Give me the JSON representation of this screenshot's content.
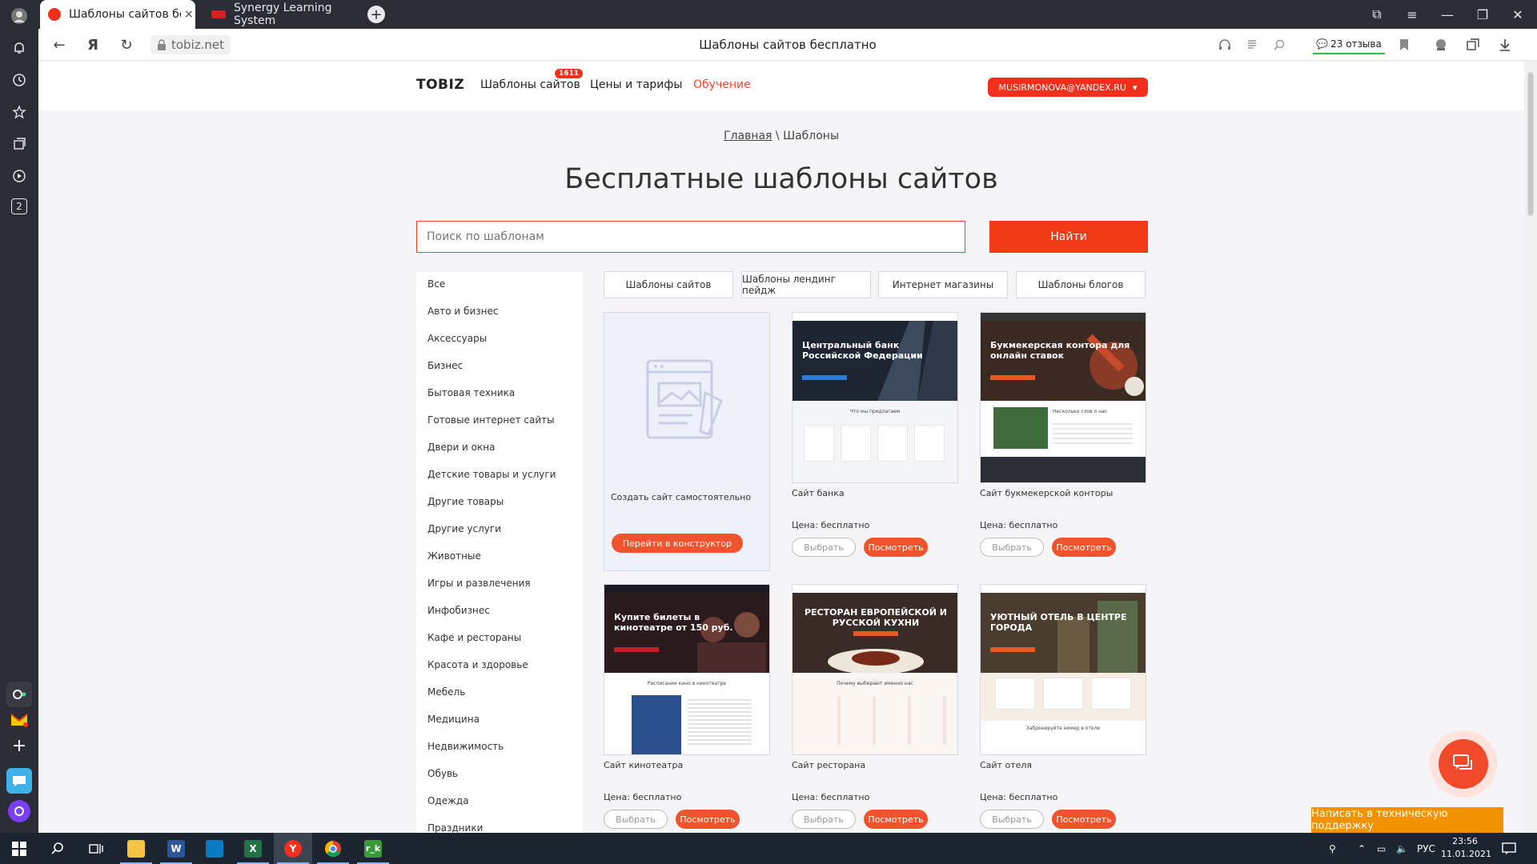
{
  "browser": {
    "tabs": [
      {
        "title": "Шаблоны сайтов бесп...",
        "active": true,
        "favicon_color": "#f0301c"
      },
      {
        "title": "Synergy Learning System",
        "active": false,
        "favicon_color": "#d42020"
      }
    ],
    "close_glyph": "×",
    "new_tab_glyph": "+",
    "url": "tobiz.net",
    "page_title": "Шаблоны сайтов бесплатно",
    "reviews_label": "23 отзыва",
    "window_buttons": [
      "⧉",
      "≡",
      "—",
      "❐",
      "✕"
    ],
    "nav_glyphs": {
      "back": "←",
      "yandex": "Я",
      "reload": "↻"
    },
    "sidebar_badge": "2"
  },
  "site": {
    "logo": "TOBIZ",
    "nav": {
      "templates": "Шаблоны сайтов",
      "templates_badge": "1611",
      "pricing": "Цены и тарифы",
      "learning": "Обучение"
    },
    "user_email": "MUSIRMONOVA@YANDEX.RU",
    "user_caret": "▾",
    "breadcrumb": {
      "home": "Главная",
      "separator": " \\ ",
      "current": "Шаблоны"
    },
    "heading": "Бесплатные шаблоны сайтов",
    "search": {
      "placeholder": "Поиск по шаблонам",
      "button": "Найти"
    },
    "categories": [
      "Все",
      "Авто и бизнес",
      "Аксессуары",
      "Бизнес",
      "Бытовая техника",
      "Готовые интернет сайты",
      "Двери и окна",
      "Детские товары и услуги",
      "Другие товары",
      "Другие услуги",
      "Животные",
      "Игры и развлечения",
      "Инфобизнес",
      "Кафе и рестораны",
      "Красота и здоровье",
      "Мебель",
      "Медицина",
      "Недвижимость",
      "Обувь",
      "Одежда",
      "Праздники"
    ],
    "filters": [
      "Шаблоны сайтов",
      "Шаблоны лендинг пейдж",
      "Интернет магазины",
      "Шаблоны блогов"
    ],
    "create_card": {
      "label": "Создать сайт самостоятельно",
      "button": "Перейти в конструктор"
    },
    "cards": [
      {
        "name": "Сайт банка",
        "price": "Цена: бесплатно",
        "hero_text": "Центральный банк Российской Федерации",
        "lower_title": "Что мы предлагаем",
        "hero_color": "#1d2533"
      },
      {
        "name": "Сайт букмекерской конторы",
        "price": "Цена: бесплатно",
        "hero_text": "Букмекерская контора для онлайн ставок",
        "lower_title": "Несколько слов о нас",
        "hero_color": "#3a2a22"
      },
      {
        "name": "Сайт кинотеатра",
        "price": "Цена: бесплатно",
        "hero_text": "Купите билеты в кинотеатре от 150 руб.",
        "lower_title": "Расписание кино в кинотеатре",
        "hero_color": "#2a1a1e"
      },
      {
        "name": "Сайт ресторана",
        "price": "Цена: бесплатно",
        "hero_text": "РЕСТОРАН ЕВРОПЕЙСКОЙ И РУССКОЙ КУХНИ",
        "lower_title": "Почему выбирают именно нас",
        "hero_color": "#3b2b26"
      },
      {
        "name": "Сайт отеля",
        "price": "Цена: бесплатно",
        "hero_text": "УЮТНЫЙ ОТЕЛЬ В ЦЕНТРЕ ГОРОДА",
        "lower_title": "Забронируйте номер в отеле",
        "hero_color": "#4a3c2e"
      }
    ],
    "choose_label": "Выбрать",
    "view_label": "Посмотреть",
    "support_label": "Написать в техническую поддержку"
  },
  "taskbar": {
    "language": "РУС",
    "time": "23:56",
    "date": "11.01.2021"
  }
}
